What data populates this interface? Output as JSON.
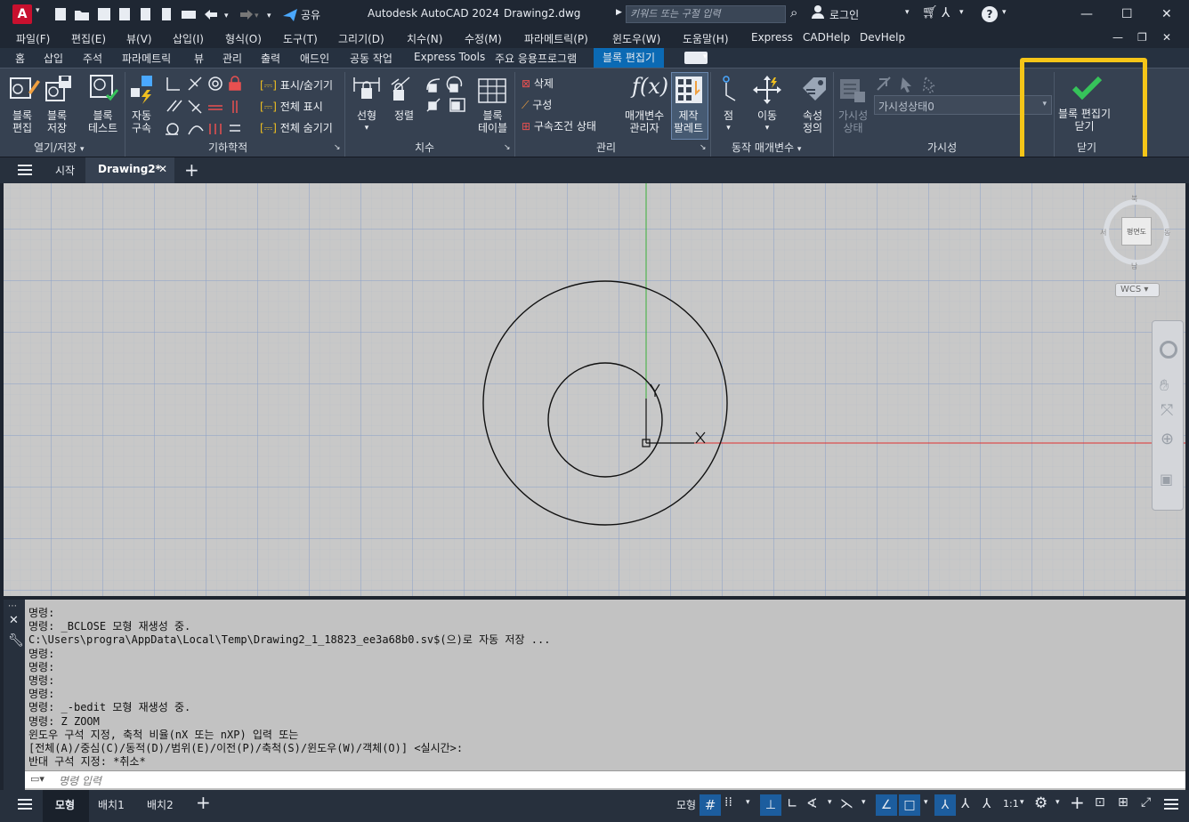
{
  "titlebar": {
    "app_letter": "A",
    "share_label": "공유",
    "app_title": "Autodesk AutoCAD 2024",
    "file_name": "Drawing2.dwg",
    "search_placeholder": "키워드 또는 구절 입력",
    "login_label": "로그인"
  },
  "menu": [
    "파일(F)",
    "편집(E)",
    "뷰(V)",
    "삽입(I)",
    "형식(O)",
    "도구(T)",
    "그리기(D)",
    "치수(N)",
    "수정(M)",
    "파라메트릭(P)",
    "윈도우(W)",
    "도움말(H)",
    "Express",
    "CADHelp",
    "DevHelp"
  ],
  "ribbon_tabs": [
    "홈",
    "삽입",
    "주석",
    "파라메트릭",
    "뷰",
    "관리",
    "출력",
    "애드인",
    "공동 작업",
    "Express Tools",
    "주요 응용프로그램",
    "블록 편집기"
  ],
  "ribbon": {
    "open_save": {
      "edit_l1": "블록",
      "edit_l2": "편집",
      "save_l1": "블록",
      "save_l2": "저장",
      "test_l1": "블록",
      "test_l2": "테스트",
      "panel": "열기/저장"
    },
    "geometry": {
      "auto_l1": "자동",
      "auto_l2": "구속",
      "showhide": "표시/숨기기",
      "showall": "전체 표시",
      "hideall": "전체 숨기기",
      "panel": "기하학적"
    },
    "dimension": {
      "linear": "선형",
      "aligned": "정렬",
      "panel": "치수"
    },
    "manage": {
      "table_l1": "블록",
      "table_l2": "테이블",
      "delete": "삭제",
      "construct": "구성",
      "status": "구속조건 상태",
      "param_l1": "매개변수",
      "param_l2": "관리자",
      "palette_l1": "제작",
      "palette_l2": "팔레트",
      "panel": "관리"
    },
    "action": {
      "point": "점",
      "move": "이동",
      "attr_l1": "속성",
      "attr_l2": "정의",
      "panel": "동작 매개변수"
    },
    "visibility": {
      "state_l1": "가시성",
      "state_l2": "상태",
      "dropdown_value": "가시성상태0",
      "panel": "가시성"
    },
    "close": {
      "label_l1": "블록 편집기",
      "label_l2": "닫기",
      "panel": "닫기"
    }
  },
  "doc_tabs": {
    "start": "시작",
    "drawing": "Drawing2*"
  },
  "viewcube": {
    "face": "평면도",
    "wcs": "WCS"
  },
  "ucs": {
    "y": "Y",
    "x": "X"
  },
  "command_history": [
    "명령:",
    "명령: _BCLOSE 모형 재생성 중.",
    "C:\\Users\\progra\\AppData\\Local\\Temp\\Drawing2_1_18823_ee3a68b0.sv$(으)로 자동 저장 ...",
    "명령:",
    "명령:",
    "명령:",
    "명령:",
    "명령: _-bedit 모형 재생성 중.",
    "명령: Z ZOOM",
    "윈도우 구석 지정, 축척 비율(nX 또는 nXP) 입력 또는",
    "[전체(A)/중심(C)/동적(D)/범위(E)/이전(P)/축척(S)/윈도우(W)/객체(O)] <실시간>:",
    "반대 구석 지정: *취소*"
  ],
  "command_placeholder": "명령 입력",
  "status": {
    "model_tab": "모형",
    "layout1": "배치1",
    "layout2": "배치2",
    "model_btn": "모형",
    "scale": "1:1"
  },
  "colors": {
    "accent_blue": "#0b6ab4",
    "highlight_box": "#f5c518",
    "canvas": "#c8c8c8",
    "grid": "#8aa0c8",
    "x_axis": "#e03030",
    "y_axis": "#3ab03a"
  },
  "icons": [
    "menu-icon",
    "new-icon",
    "open-icon",
    "save-icon",
    "saveas-icon",
    "print-icon",
    "undo-icon",
    "redo-icon",
    "share-icon",
    "search-icon",
    "user-icon",
    "cart-icon",
    "help-icon",
    "close-icon",
    "checkmark-icon",
    "gear-icon"
  ]
}
